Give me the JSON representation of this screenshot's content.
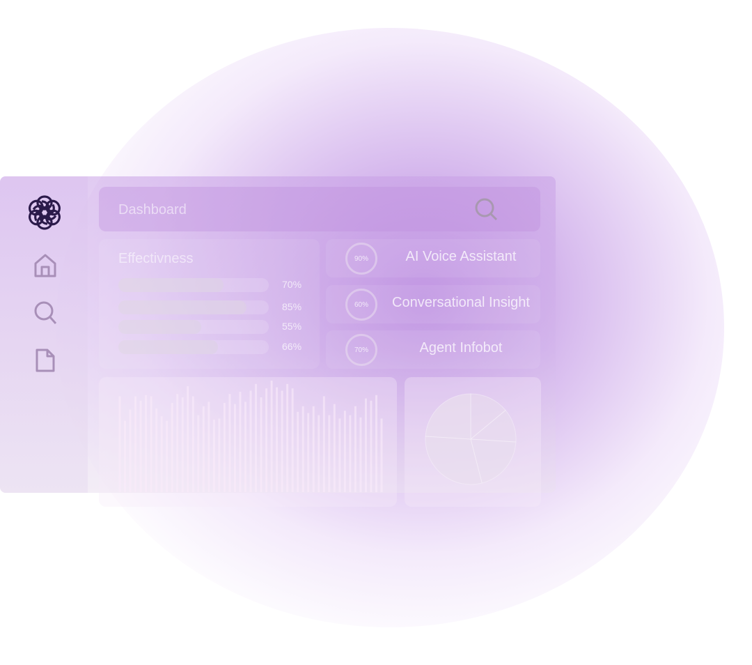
{
  "brand": {
    "logo": "openai-logo"
  },
  "sidebar": {
    "items": [
      {
        "icon": "home-icon"
      },
      {
        "icon": "search-icon"
      },
      {
        "icon": "document-icon"
      }
    ]
  },
  "header": {
    "title": "Dashboard",
    "search_icon": "search-icon"
  },
  "effectiveness": {
    "title": "Effectivness",
    "rows": [
      {
        "value": 70,
        "label": "70%"
      },
      {
        "value": 85,
        "label": "85%"
      },
      {
        "value": 55,
        "label": "55%"
      },
      {
        "value": 66,
        "label": "66%"
      }
    ]
  },
  "agents": [
    {
      "name": "AI Voice Assistant",
      "percent": 90,
      "percent_label": "90%"
    },
    {
      "name": "Conversational Insight",
      "percent": 60,
      "percent_label": "60%"
    },
    {
      "name": "Agent Infobot",
      "percent": 70,
      "percent_label": "70%"
    }
  ],
  "activity_chart": {
    "type": "bar",
    "values": [
      0.86,
      0.64,
      0.74,
      0.86,
      0.82,
      0.87,
      0.86,
      0.75,
      0.68,
      0.64,
      0.8,
      0.88,
      0.85,
      0.95,
      0.86,
      0.69,
      0.77,
      0.81,
      0.65,
      0.66,
      0.8,
      0.88,
      0.79,
      0.9,
      0.81,
      0.91,
      0.97,
      0.85,
      0.93,
      1.0,
      0.94,
      0.91,
      0.97,
      0.93,
      0.72,
      0.77,
      0.71,
      0.77,
      0.69,
      0.86,
      0.69,
      0.79,
      0.66,
      0.73,
      0.69,
      0.77,
      0.67,
      0.84,
      0.82,
      0.87,
      0.66
    ]
  },
  "pie_chart": {
    "type": "pie",
    "values": [
      0.14,
      0.12,
      0.2,
      0.3,
      0.24
    ]
  },
  "colors": {
    "accent": "#b98ad8",
    "logo": "#2b1a4a"
  }
}
